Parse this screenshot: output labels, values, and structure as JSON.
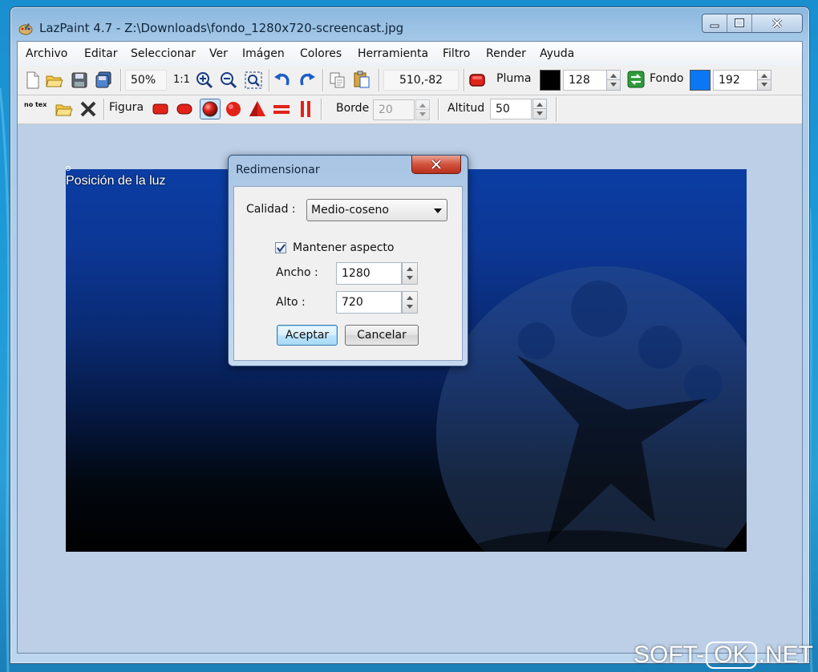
{
  "window": {
    "title": "LazPaint 4.7 - Z:\\Downloads\\fondo_1280x720-screencast.jpg"
  },
  "menu": [
    "Archivo",
    "Editar",
    "Seleccionar",
    "Ver",
    "Imágen",
    "Colores",
    "Herramienta",
    "Filtro",
    "Render",
    "Ayuda"
  ],
  "toolbar1": {
    "zoom": "50%",
    "zoom_reset": "1:1",
    "coords": "510,-82",
    "pen_label": "Pluma",
    "pen_color": "#000000",
    "pen_alpha": "128",
    "back_label": "Fondo",
    "back_color": "#0a78f5",
    "back_alpha": "192"
  },
  "toolbar2": {
    "notex": "no tex",
    "shape_label": "Figura",
    "border_label": "Borde",
    "border_value": "20",
    "altitude_label": "Altitud",
    "altitude_value": "50"
  },
  "canvas": {
    "light_label": "Posición de la luz"
  },
  "dialog": {
    "title": "Redimensionar",
    "quality_label": "Calidad :",
    "quality_value": "Medio-coseno",
    "keep_aspect_label": "Mantener aspecto",
    "keep_aspect_checked": true,
    "width_label": "Ancho :",
    "width_value": "1280",
    "height_label": "Alto :",
    "height_value": "720",
    "ok_label": "Aceptar",
    "cancel_label": "Cancelar"
  },
  "watermark": {
    "part1": "SOFT-",
    "part2": "OK",
    "part3": ".NET"
  },
  "colors": {
    "accent_red": "#d01a12",
    "canvas_bg": "#bccfe6"
  }
}
